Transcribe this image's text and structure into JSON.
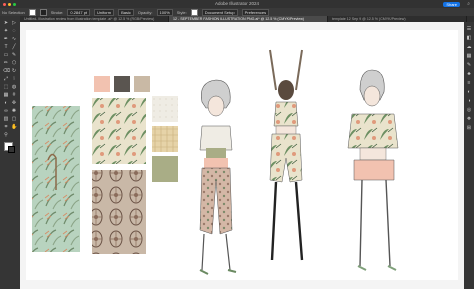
{
  "window": {
    "title": "Adobe Illustrator 2024",
    "share_label": "Share",
    "traffic_colors": [
      "#ff5f57",
      "#febc2e",
      "#28c840"
    ]
  },
  "control_bar": {
    "selection_label": "No Selection",
    "stroke_label": "Stroke:",
    "stroke_value": "0.2847 pt",
    "brush_value": "Uniform",
    "basic_label": "Basic",
    "opacity_label": "Opacity:",
    "opacity_value": "100%",
    "style_label": "Style:",
    "doc_setup_label": "Document Setup",
    "preferences_label": "Preferences"
  },
  "tabs": [
    {
      "label": "Untitled- Illustration review from illustration template .ai* @ 12.5 % (RGB/Preview)",
      "active": false
    },
    {
      "label": "12 - SEPTEMBER FASHION ILLUSTRATION PNG.ai* @ 12.5 % (CMYK/Preview)",
      "active": true
    },
    {
      "label": "template 12 Sep 9 @ 12.5 % (CMYK/Preview)",
      "active": false
    }
  ],
  "left_tools": [
    "selection-tool-icon",
    "direct-selection-icon",
    "magic-wand-icon",
    "lasso-icon",
    "pen-icon",
    "curvature-icon",
    "type-icon",
    "line-icon",
    "rectangle-icon",
    "paintbrush-icon",
    "pencil-icon",
    "shaper-icon",
    "eraser-icon",
    "rotate-icon",
    "scale-icon",
    "width-icon",
    "free-transform-icon",
    "shape-builder-icon",
    "perspective-icon",
    "mesh-icon",
    "gradient-icon",
    "eyedropper-icon",
    "blend-icon",
    "symbol-sprayer-icon",
    "column-graph-icon",
    "artboard-icon",
    "slice-icon",
    "hand-icon",
    "zoom-icon"
  ],
  "right_tools": [
    "properties-icon",
    "layers-icon",
    "libraries-icon",
    "swatches-icon",
    "brushes-icon",
    "symbols-icon",
    "stroke-icon",
    "gradient-panel-icon",
    "transparency-icon",
    "appearance-icon",
    "graphic-styles-icon",
    "align-icon"
  ],
  "colors": {
    "fill": "#ffffff",
    "stroke": "#000000",
    "accent": "#1473e6",
    "mood_swatches": [
      "#f2c2b0",
      "#5a5550",
      "#c9b9a5",
      "#efece4",
      "#e9d9b6",
      "#a9ad86"
    ]
  }
}
